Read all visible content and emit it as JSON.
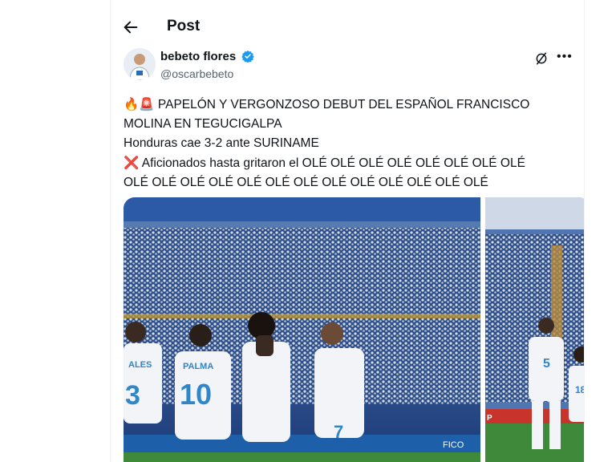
{
  "header": {
    "title": "Post"
  },
  "author": {
    "name": "bebeto flores",
    "handle": "@oscarbebeto"
  },
  "post": {
    "line1_emoji": "🔥🚨",
    "line1": "PAPELÓN Y VERGONZOSO DEBUT DEL ESPAÑOL FRANCISCO",
    "line2": "MOLINA EN TEGUCIGALPA",
    "line3": "Honduras cae 3-2 ante SURINAME",
    "line4_emoji": "❌",
    "line4": "Aficionados hasta gritaron el OLÉ OLÉ OLÉ OLÉ OLÉ OLÉ OLÉ OLÉ",
    "line5": "OLÉ OLÉ OLÉ OLÉ OLÉ OLÉ OLÉ OLÉ OLÉ OLÉ OLÉ OLÉ OLÉ"
  },
  "photo1": {
    "jersey_a": "3",
    "jersey_a_name": "ALES",
    "jersey_b": "10",
    "jersey_b_name": "PALMA",
    "jersey_c": "7",
    "board": "FICO"
  },
  "photo2": {
    "jersey": "5",
    "jersey_b": "18",
    "board": "P"
  },
  "colors": {
    "verified": "#1d9bf0",
    "muted": "#536471",
    "sky": "#1b3a78",
    "jersey": "#f2f4f8",
    "grass": "#3f8a3a"
  }
}
